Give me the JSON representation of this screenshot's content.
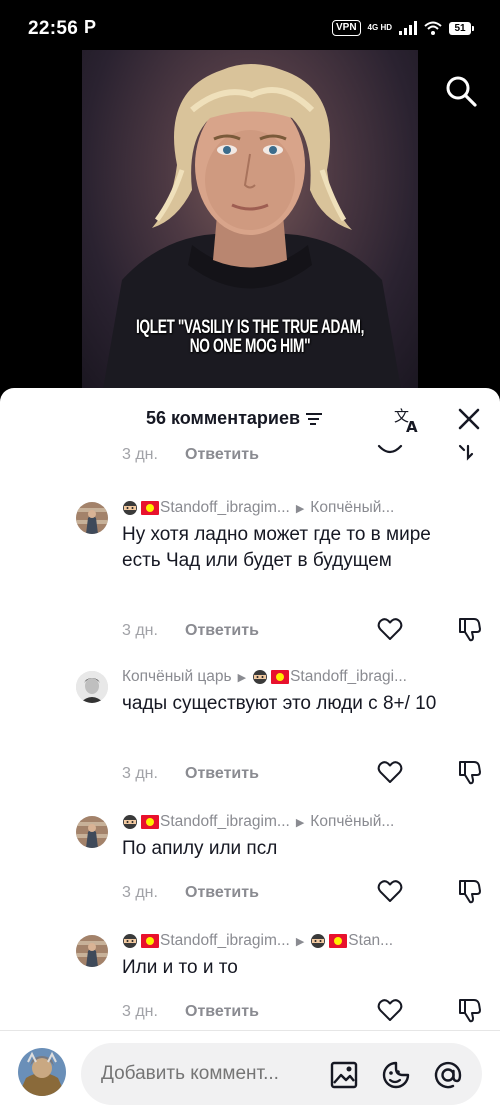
{
  "status_bar": {
    "time": "22:56",
    "app_indicator": "P",
    "vpn": "VPN",
    "network_top": "4G HD",
    "battery": "51"
  },
  "video": {
    "caption_line1": "IQLET \"VASILIY IS THE TRUE ADAM,",
    "caption_line2": "NO ONE MOG HIM\""
  },
  "comments_sheet": {
    "title": "56 комментариев",
    "icons": [
      "sort-icon",
      "translate-icon",
      "close-icon"
    ],
    "top_partial_meta": {
      "date": "3 дн.",
      "reply": "Ответить"
    },
    "comments": [
      {
        "user": "Standoff_ibragim...",
        "reply_to": "Копчёный...",
        "text": "Ну хотя ладно может где то в мире есть Чад или будет в будущем",
        "date": "3 дн.",
        "reply": "Ответить"
      },
      {
        "user": "Копчёный царь",
        "reply_to": "Standoff_ibragi...",
        "text": "чады существуют это люди с 8+/ 10",
        "date": "3 дн.",
        "reply": "Ответить"
      },
      {
        "user": "Standoff_ibragim...",
        "reply_to": "Копчёный...",
        "text": "По апилу или псл",
        "date": "3 дн.",
        "reply": "Ответить"
      },
      {
        "user": "Standoff_ibragim...",
        "reply_to": "Stan...",
        "text": "Или и то и то",
        "date": "3 дн.",
        "reply": "Ответить"
      }
    ]
  },
  "input_bar": {
    "placeholder": "Добавить коммент...",
    "icons": [
      "image-icon",
      "emoji-icon",
      "mention-icon"
    ]
  },
  "colors": {
    "accent_text": "#161823",
    "muted_text": "#8a8b91",
    "kyrgyz_flag_red": "#e8112d"
  }
}
